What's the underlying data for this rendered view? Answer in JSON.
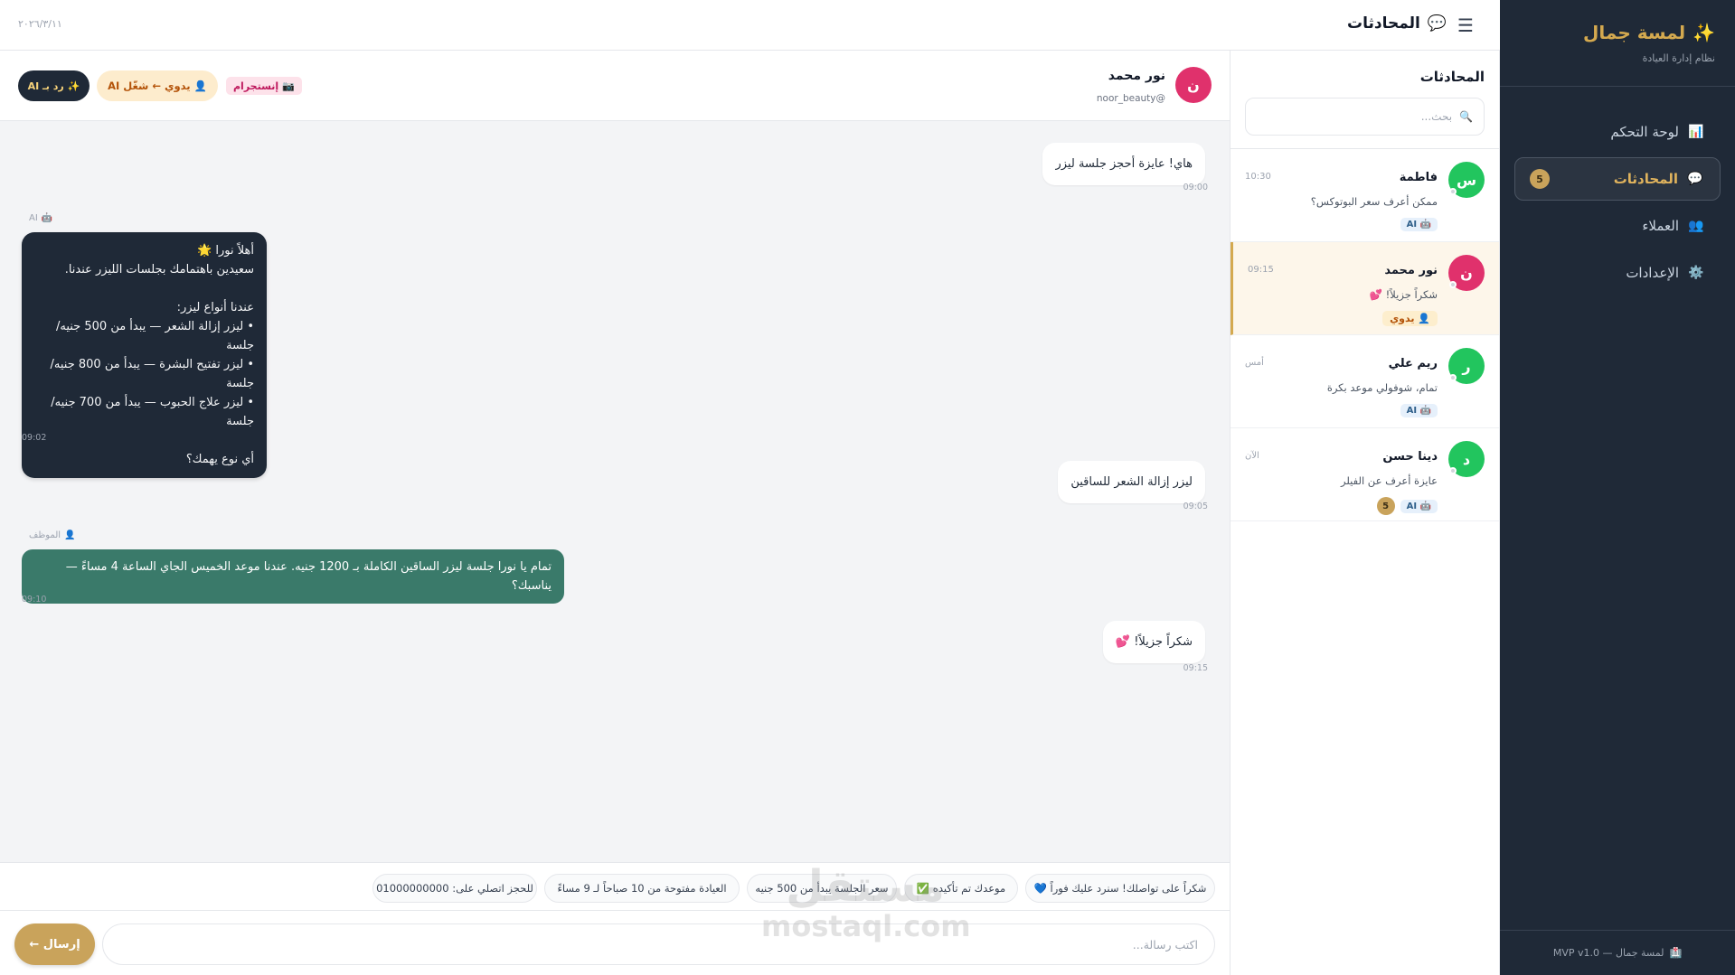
{
  "sidebar": {
    "brand_title": "لمسة جمال",
    "brand_icon": "sparkle-icon",
    "brand_sub": "نظام إدارة العيادة",
    "items": [
      {
        "label": "لوحة التحكم",
        "icon": "dashboard-icon"
      },
      {
        "label": "المحادثات",
        "icon": "chat-icon",
        "badge": "5"
      },
      {
        "label": "العملاء",
        "icon": "users-icon"
      },
      {
        "label": "الإعدادات",
        "icon": "gear-icon"
      }
    ],
    "footer": "لمسة جمال — MVP v1.0"
  },
  "topbar": {
    "title": "المحادثات",
    "date": "٢٠٢٦/٣/١١"
  },
  "conv_list": {
    "title": "المحادثات",
    "search_placeholder": "بحث...",
    "items": [
      {
        "avatar": "س",
        "avatar_color": "#22c55e",
        "name": "فاطمة",
        "time": "10:30",
        "preview": "ممكن أعرف سعر البوتوكس؟",
        "tag": "AI"
      },
      {
        "avatar": "ن",
        "avatar_color": "#e0316c",
        "name": "نور محمد",
        "time": "09:15",
        "preview": "شكراً جزيلاً! 💕",
        "tag": "يدوي"
      },
      {
        "avatar": "ر",
        "avatar_color": "#22c55e",
        "name": "ريم علي",
        "time": "أمس",
        "preview": "تمام، شوفولي موعد بكرة",
        "tag": "AI"
      },
      {
        "avatar": "د",
        "avatar_color": "#22c55e",
        "name": "دينا حسن",
        "time": "الآن",
        "preview": "عايزة أعرف عن الفيلر",
        "tag": "AI",
        "count": "5"
      }
    ]
  },
  "chat_header": {
    "avatar": "ن",
    "name": "نور محمد",
    "handle": "noor_beauty@",
    "channel_tag": "إنستجرام",
    "manual_button": "يدوي ← شغّل AI",
    "ai_button": "رد بـ AI"
  },
  "messages": [
    {
      "type": "incoming",
      "text": "هاي! عايزة أحجز جلسة ليزر",
      "time": "09:00"
    },
    {
      "type": "ai",
      "sender": "AI",
      "text": "أهلاً نورا 🌟\nسعيدين باهتمامك بجلسات الليزر عندنا.\n\nعندنا أنواع ليزر:\n• ليزر إزالة الشعر — يبدأ من 500 جنيه/جلسة\n• ليزر تفتيح البشرة — يبدأ من 800 جنيه/جلسة\n• ليزر علاج الحبوب — يبدأ من 700 جنيه/جلسة\n\nأي نوع يهمك؟",
      "time": "09:02"
    },
    {
      "type": "incoming",
      "text": "ليزر إزالة الشعر للساقين",
      "time": "09:05"
    },
    {
      "type": "staff",
      "sender": "الموظف",
      "text": "تمام يا نورا جلسة ليزر الساقين الكاملة بـ 1200 جنيه. عندنا موعد الخميس الجاي الساعة 4 مساءً — يناسبك؟",
      "time": "09:10"
    },
    {
      "type": "incoming",
      "text": "شكراً جزيلاً! 💕",
      "time": "09:15"
    }
  ],
  "quick_replies": [
    "شكراً على تواصلك! سنرد عليك فوراً 💙",
    "موعدك تم تأكيده ✅",
    "سعر الجلسة يبدأ من 500 جنيه",
    "العيادة مفتوحة من 10 صباحاً لـ 9 مساءً",
    "للحجز اتصلي على: 01000000000"
  ],
  "composer": {
    "placeholder": "اكتب رسالة...",
    "send_label": "إرسال ←"
  },
  "watermark": {
    "line1": "مستقل",
    "line2": "mostaql.com"
  },
  "colors": {
    "sidebar_bg": "#1f2937",
    "accent_gold": "#c9a35b",
    "staff_bubble": "#3a7a6a",
    "ai_bubble": "#1f2937"
  }
}
